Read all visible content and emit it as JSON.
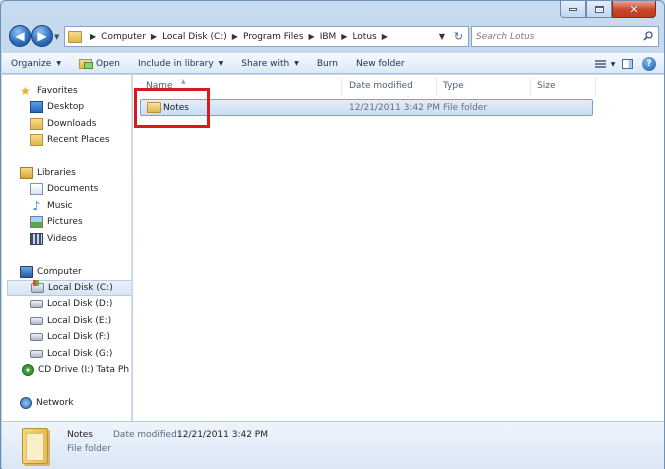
{
  "breadcrumbs": [
    "Computer",
    "Local Disk (C:)",
    "Program Files",
    "IBM",
    "Lotus"
  ],
  "search": {
    "placeholder": "Search Lotus"
  },
  "toolbar": {
    "organize": "Organize",
    "open": "Open",
    "include": "Include in library",
    "share": "Share with",
    "burn": "Burn",
    "new_folder": "New folder"
  },
  "nav": {
    "favorites": {
      "label": "Favorites",
      "items": [
        "Desktop",
        "Downloads",
        "Recent Places"
      ]
    },
    "libraries": {
      "label": "Libraries",
      "items": [
        "Documents",
        "Music",
        "Pictures",
        "Videos"
      ]
    },
    "computer": {
      "label": "Computer",
      "items": [
        "Local Disk (C:)",
        "Local Disk (D:)",
        "Local Disk (E:)",
        "Local Disk (F:)",
        "Local Disk (G:)",
        "CD Drive (I:) Tata Ph"
      ],
      "selected": "Local Disk (C:)"
    },
    "network": {
      "label": "Network"
    }
  },
  "columns": {
    "name": "Name",
    "date": "Date modified",
    "type": "Type",
    "size": "Size"
  },
  "files": [
    {
      "name": "Notes",
      "date": "12/21/2011 3:42 PM",
      "type": "File folder",
      "size": ""
    }
  ],
  "details": {
    "name": "Notes",
    "date_label": "Date modified:",
    "date": "12/21/2011 3:42 PM",
    "type": "File folder"
  },
  "colors": {
    "highlight": "#d9191e",
    "selection": "#c9ddf6",
    "accent": "#2a6bbd"
  },
  "icons": [
    "back-arrow-icon",
    "forward-arrow-icon",
    "folder-icon",
    "refresh-icon",
    "search-icon",
    "views-icon",
    "preview-pane-icon",
    "help-icon",
    "star-icon",
    "drive-icon",
    "network-icon"
  ]
}
